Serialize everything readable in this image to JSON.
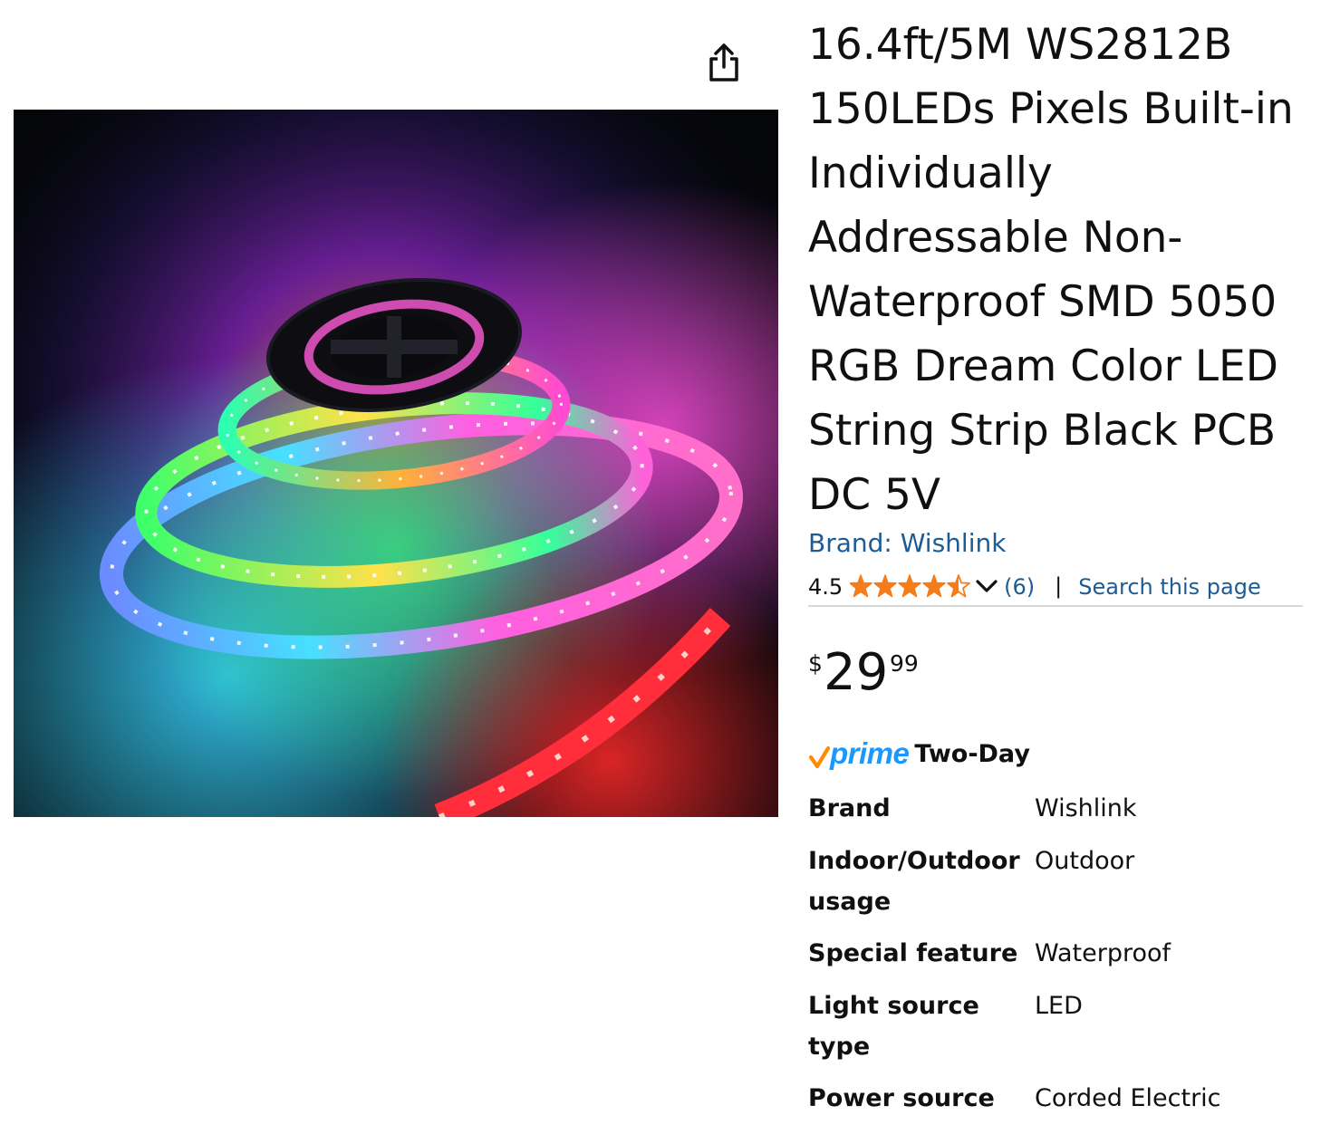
{
  "title": "16.4ft/5M WS2812B 150LEDs Pixels Built-in Individually Addressable Non-Waterproof SMD 5050 RGB Dream Color LED String Strip Black PCB DC 5V",
  "share": {
    "icon": "share-icon"
  },
  "image": {
    "alt": "LED strip reel"
  },
  "brand": {
    "text": "Brand: Wishlink"
  },
  "rating": {
    "value": "4.5",
    "stars": 4.5,
    "count_text": "(6)",
    "separator": "|",
    "search_text": "Search this page"
  },
  "price": {
    "symbol": "$",
    "whole": "29",
    "fraction": "99"
  },
  "prime": {
    "logo_text": "prime",
    "service": "Two-Day"
  },
  "specs": [
    {
      "label": "Brand",
      "value": "Wishlink"
    },
    {
      "label": "Indoor/Outdoor usage",
      "value": "Outdoor"
    },
    {
      "label": "Special feature",
      "value": "Waterproof"
    },
    {
      "label": "Light source type",
      "value": "LED"
    },
    {
      "label": "Power source",
      "value": "Corded Electric"
    }
  ],
  "colors": {
    "link": "#1d5b94",
    "star": "#f57c1b",
    "prime_blue": "#1a98ff",
    "prime_check": "#ff8c00",
    "divider": "#d5d9d9"
  }
}
